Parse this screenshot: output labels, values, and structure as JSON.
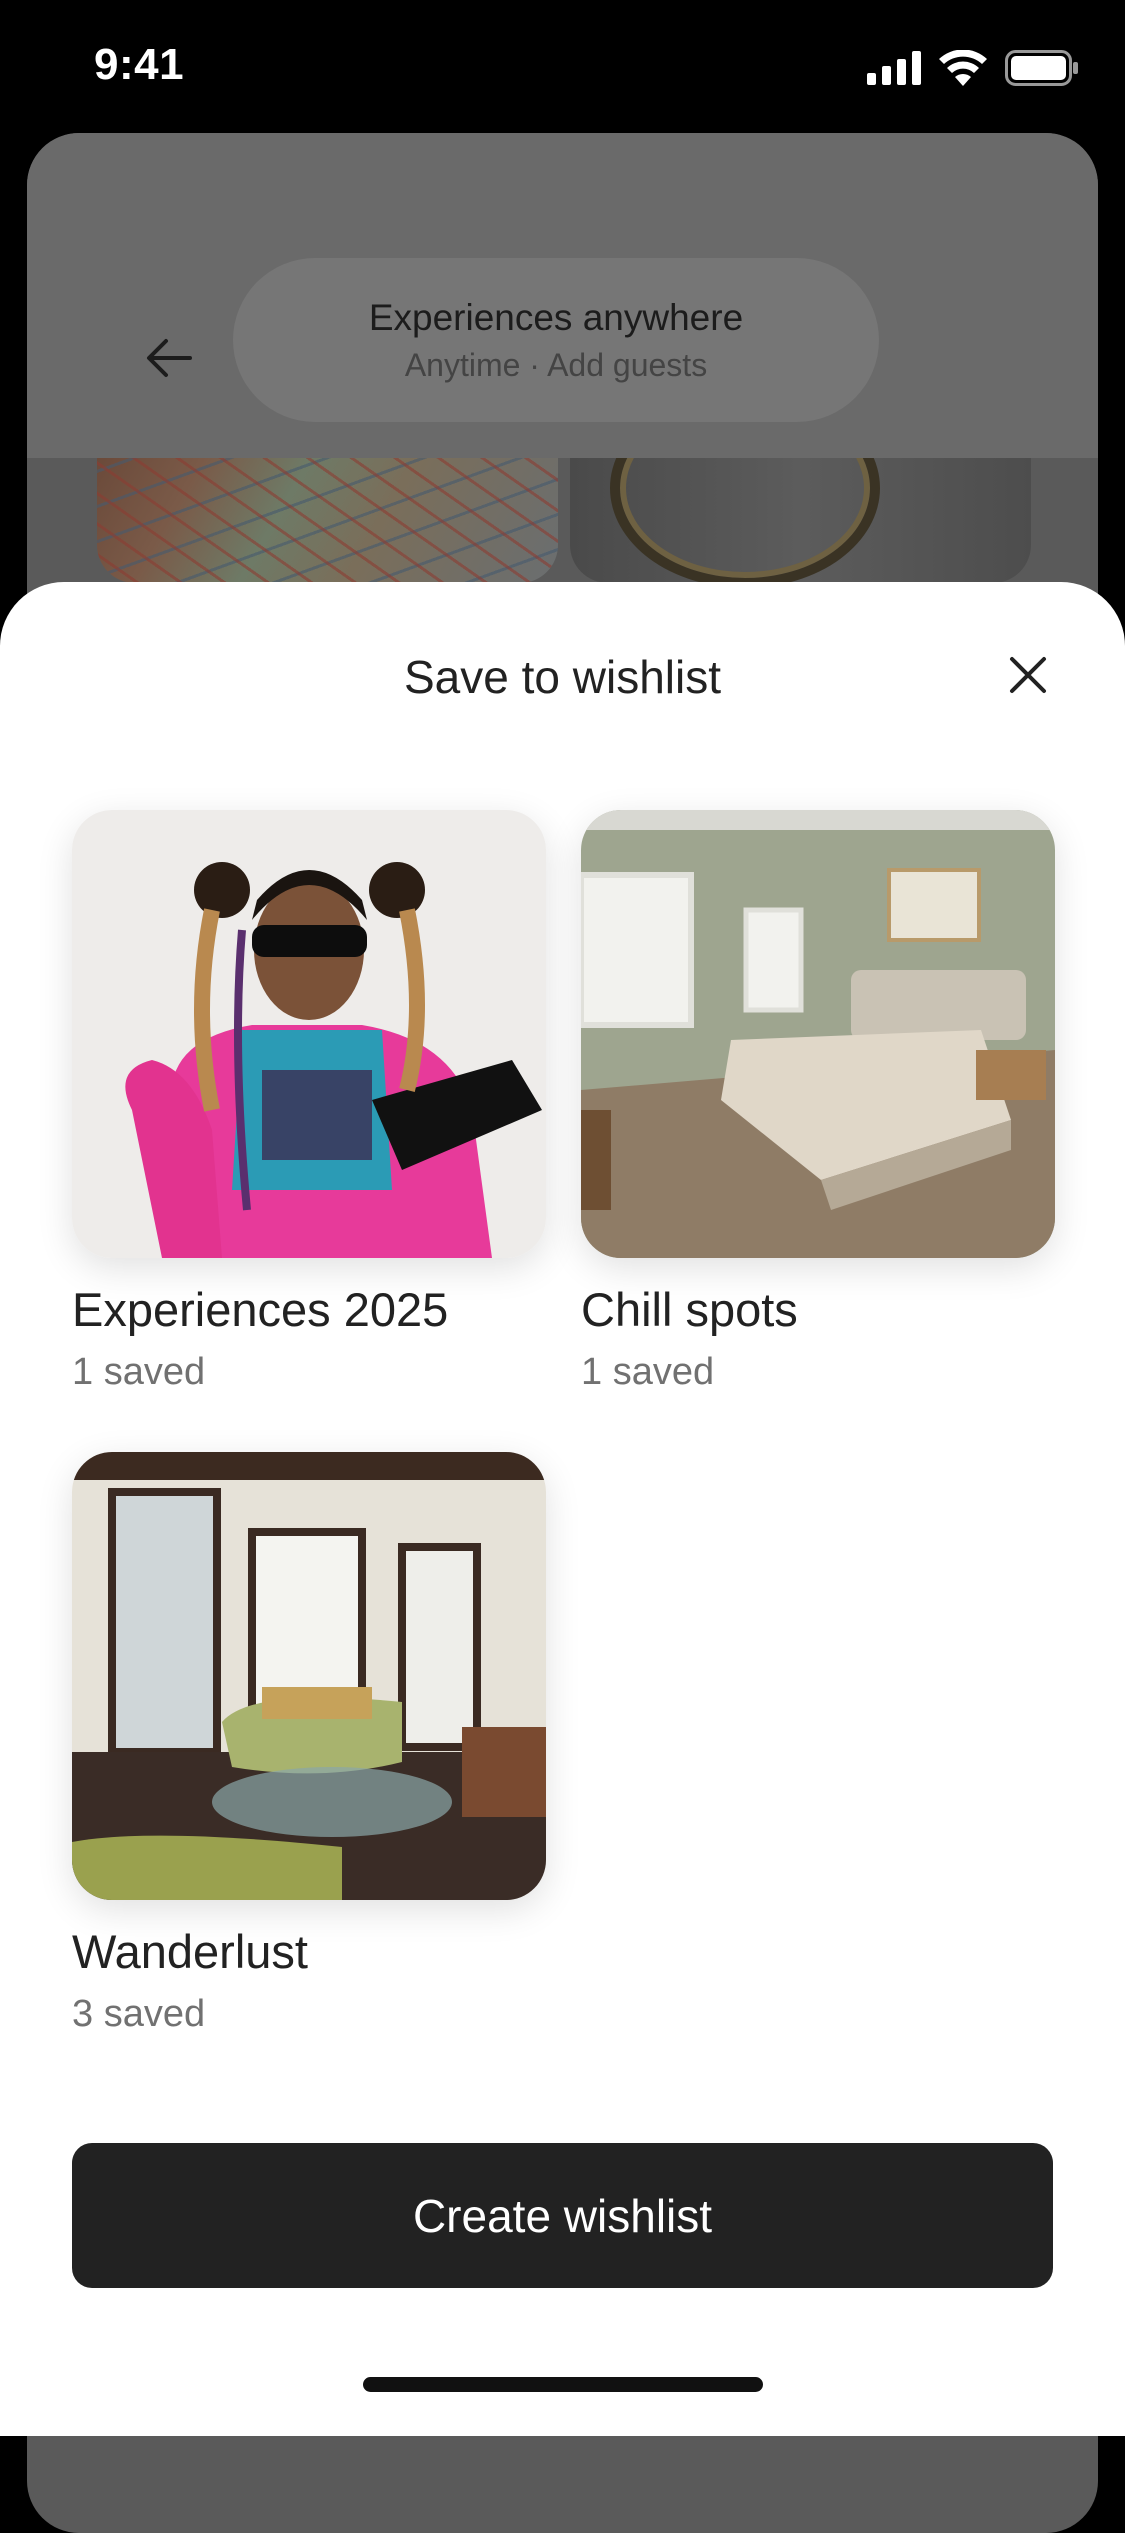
{
  "status_bar": {
    "time": "9:41"
  },
  "background": {
    "search": {
      "title": "Experiences anywhere",
      "subtitle": "Anytime · Add guests"
    }
  },
  "sheet": {
    "title": "Save to wishlist",
    "wishlists": [
      {
        "name": "Experiences 2025",
        "count": "1 saved"
      },
      {
        "name": "Chill spots",
        "count": "1 saved"
      },
      {
        "name": "Wanderlust",
        "count": "3 saved"
      }
    ],
    "create_button": "Create wishlist"
  },
  "icons": {
    "back": "arrow-left-icon",
    "close": "close-icon",
    "signal": "cellular-signal-icon",
    "wifi": "wifi-icon",
    "battery": "battery-icon"
  }
}
